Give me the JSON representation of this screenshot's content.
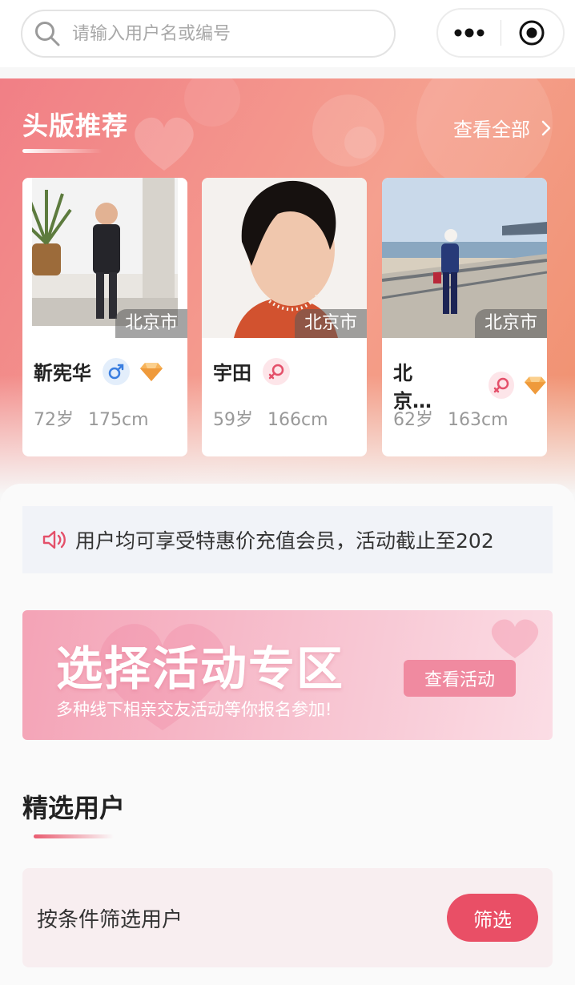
{
  "search": {
    "placeholder": "请输入用户名或编号"
  },
  "featured": {
    "title": "头版推荐",
    "view_all": "查看全部",
    "cards": [
      {
        "city": "北京市",
        "name": "靳宪华",
        "gender": "male",
        "vip": true,
        "age": "72岁",
        "height": "175cm"
      },
      {
        "city": "北京市",
        "name": "宇田",
        "gender": "female",
        "vip": false,
        "age": "59岁",
        "height": "166cm"
      },
      {
        "city": "北京市",
        "name": "北京…",
        "gender": "female",
        "vip": true,
        "age": "62岁",
        "height": "163cm"
      }
    ]
  },
  "notice": {
    "text": "用户均可享受特惠价充值会员，活动截止至202"
  },
  "banner": {
    "title": "选择活动专区",
    "subtitle": "多种线下相亲交友活动等你报名参加!",
    "button": "查看活动"
  },
  "selected": {
    "title": "精选用户"
  },
  "filter": {
    "label": "按条件筛选用户",
    "button": "筛选"
  },
  "icons": {
    "search": "search-icon",
    "more": "more-dots-icon",
    "target": "target-icon",
    "arrow": "chevron-right-icon",
    "male": "male-symbol-icon",
    "female": "female-symbol-icon",
    "vip": "diamond-icon",
    "speaker": "speaker-icon"
  },
  "colors": {
    "accent": "#e94f66",
    "hero": "#f17f86",
    "male": "#3a7ee0",
    "female": "#e4506a",
    "vip": "#f2a24a"
  }
}
